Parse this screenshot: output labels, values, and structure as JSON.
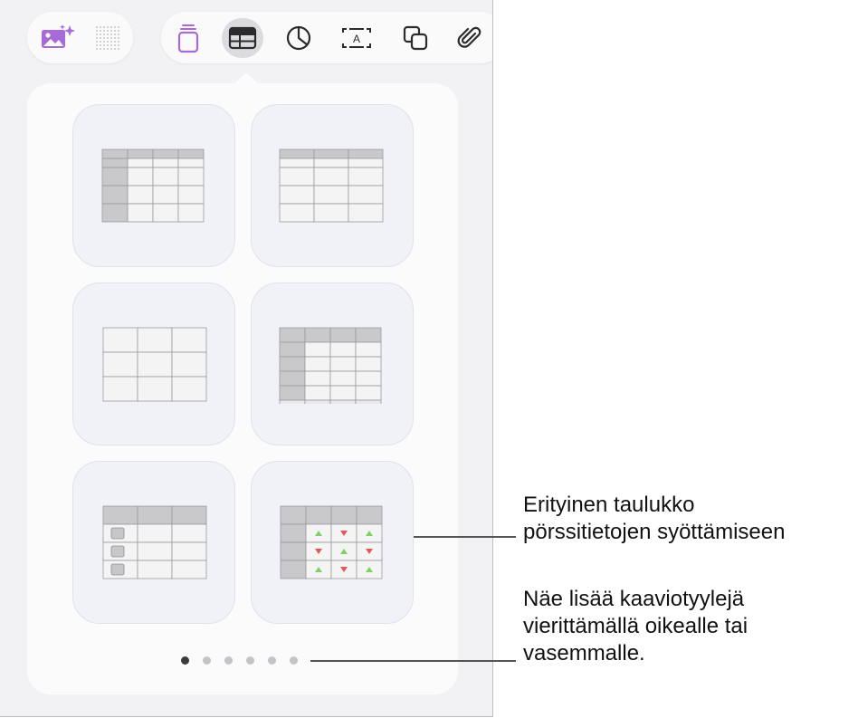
{
  "toolbar": {
    "left_group": [
      {
        "name": "image-generate",
        "icon": "image-sparkle-icon"
      },
      {
        "name": "grid",
        "icon": "dot-grid-icon"
      }
    ],
    "right_group": [
      {
        "name": "shape-stack",
        "icon": "stacked-rectangle-icon",
        "color": "#a66ad9"
      },
      {
        "name": "table",
        "icon": "table-icon",
        "active": true
      },
      {
        "name": "chart",
        "icon": "pie-chart-icon"
      },
      {
        "name": "text-box",
        "icon": "text-box-icon",
        "label": "A"
      },
      {
        "name": "shapes",
        "icon": "shapes-icon"
      },
      {
        "name": "attachment",
        "icon": "paperclip-icon"
      }
    ],
    "accent_color": "#a66ad9"
  },
  "table_styles": [
    {
      "name": "header-row-and-column"
    },
    {
      "name": "header-row"
    },
    {
      "name": "plain"
    },
    {
      "name": "header-footer"
    },
    {
      "name": "checklist"
    },
    {
      "name": "stock"
    }
  ],
  "stock_arrows": [
    [
      "up",
      "down",
      "up"
    ],
    [
      "down",
      "up",
      "down"
    ],
    [
      "up",
      "down",
      "up"
    ]
  ],
  "colors": {
    "up": "#7fcf6a",
    "down": "#e8565a",
    "header_cell": "#c9c9cc",
    "body_cell": "#f4f4f5",
    "grid_line": "#9a9a9e"
  },
  "pagination": {
    "total": 6,
    "active_index": 0
  },
  "callouts": {
    "stock": {
      "line1": "Erityinen taulukko",
      "line2": "pörssitietojen syöttämiseen"
    },
    "scroll": {
      "line1": "Näe lisää kaaviotyylejä",
      "line2": "vierittämällä oikealle tai",
      "line3": "vasemmalle."
    }
  }
}
